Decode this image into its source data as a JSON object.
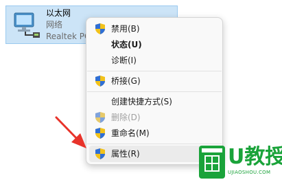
{
  "adapter": {
    "name": "以太网",
    "network": "网络",
    "driver": "Realtek PCIe GbE Family Controller",
    "icon": "network-adapter-icon"
  },
  "menu": {
    "items": [
      {
        "label": "禁用(B)",
        "icon": "shield-icon"
      },
      {
        "label": "状态(U)"
      },
      {
        "label": "诊断(I)"
      },
      {
        "label": "桥接(G)",
        "icon": "shield-icon"
      },
      {
        "label": "创建快捷方式(S)"
      },
      {
        "label": "删除(D)",
        "icon": "shield-icon"
      },
      {
        "label": "重命名(M)",
        "icon": "shield-icon"
      },
      {
        "label": "属性(R)",
        "icon": "shield-icon"
      }
    ]
  },
  "annotation": {
    "color": "#e8332a"
  },
  "watermark": {
    "text": "U教授",
    "url": "UJIAOSHOU.COM",
    "color": "#1aa33a"
  }
}
